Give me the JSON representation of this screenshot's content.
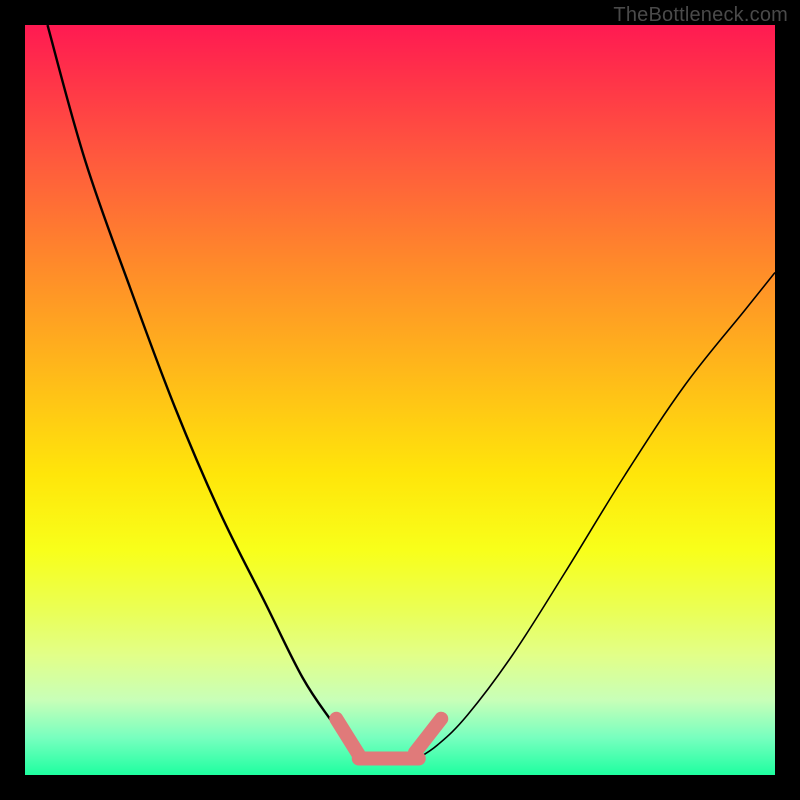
{
  "watermark": "TheBottleneck.com",
  "chart_data": {
    "type": "line",
    "title": "",
    "xlabel": "",
    "ylabel": "",
    "xlim": [
      0,
      100
    ],
    "ylim": [
      0,
      100
    ],
    "grid": false,
    "series": [
      {
        "name": "left-curve",
        "x": [
          3,
          8,
          14,
          20,
          26,
          32,
          37,
          41,
          43.5,
          45
        ],
        "values": [
          100,
          82,
          65,
          49,
          35,
          23,
          13,
          7,
          3.5,
          2
        ]
      },
      {
        "name": "right-curve",
        "x": [
          52,
          55,
          59,
          65,
          72,
          80,
          88,
          96,
          100
        ],
        "values": [
          2,
          4,
          8,
          16,
          27,
          40,
          52,
          62,
          67
        ]
      },
      {
        "name": "trough-marker-left",
        "x": [
          41.5,
          44.5
        ],
        "values": [
          7.5,
          2.7
        ]
      },
      {
        "name": "trough-marker-bottom",
        "x": [
          44.5,
          52.5
        ],
        "values": [
          2.2,
          2.2
        ]
      },
      {
        "name": "trough-marker-right",
        "x": [
          52,
          55.5
        ],
        "values": [
          3,
          7.5
        ]
      }
    ],
    "styles": {
      "left-curve": {
        "stroke": "#000000",
        "width": 2.4
      },
      "right-curve": {
        "stroke": "#000000",
        "width": 1.6
      },
      "trough-marker-left": {
        "stroke": "#e07a7a",
        "width": 14,
        "linecap": "round"
      },
      "trough-marker-bottom": {
        "stroke": "#e07a7a",
        "width": 14,
        "linecap": "round"
      },
      "trough-marker-right": {
        "stroke": "#e07a7a",
        "width": 14,
        "linecap": "round"
      }
    }
  }
}
